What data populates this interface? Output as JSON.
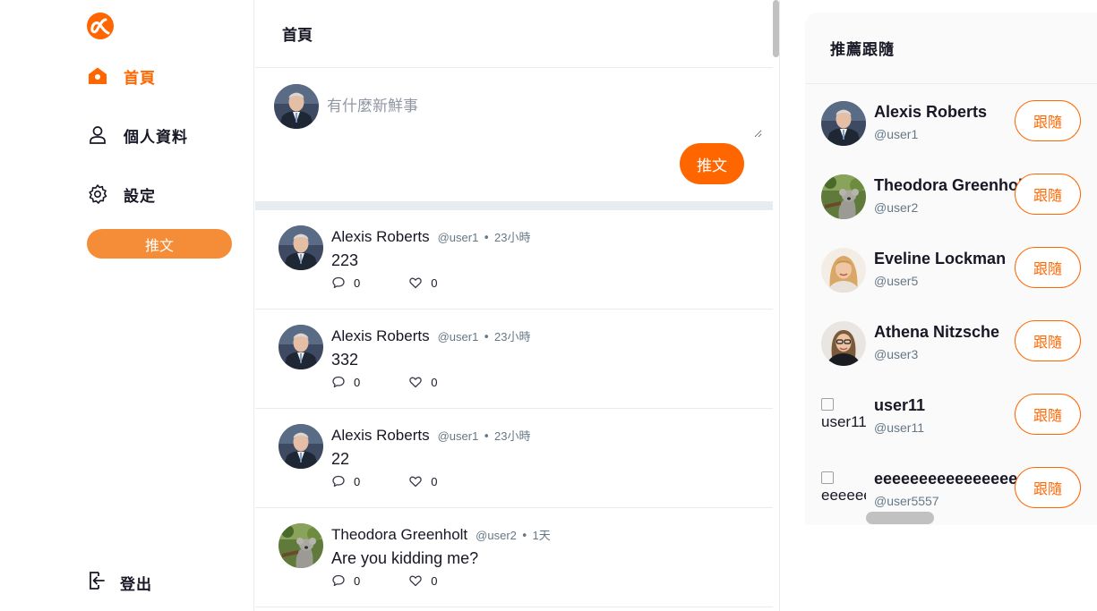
{
  "colors": {
    "accent": "#ff6600",
    "accent_soft": "#f58c37",
    "border": "#e6ecf0",
    "muted": "#657786"
  },
  "sidebar": {
    "logo_icon": "alphitter-logo",
    "nav": [
      {
        "label": "首頁",
        "icon": "home-icon",
        "active": true
      },
      {
        "label": "個人資料",
        "icon": "user-icon",
        "active": false
      },
      {
        "label": "設定",
        "icon": "gear-icon",
        "active": false
      }
    ],
    "tweet_button": "推文",
    "logout": {
      "label": "登出",
      "icon": "logout-icon"
    }
  },
  "main": {
    "title": "首頁",
    "composer": {
      "placeholder": "有什麼新鮮事",
      "submit": "推文"
    },
    "tweets": [
      {
        "name": "Alexis Roberts",
        "handle": "@user1",
        "sep": "•",
        "time": "23小時",
        "content": "223",
        "replies": "0",
        "likes": "0",
        "avatar": "man"
      },
      {
        "name": "Alexis Roberts",
        "handle": "@user1",
        "sep": "•",
        "time": "23小時",
        "content": "332",
        "replies": "0",
        "likes": "0",
        "avatar": "man"
      },
      {
        "name": "Alexis Roberts",
        "handle": "@user1",
        "sep": "•",
        "time": "23小時",
        "content": "22",
        "replies": "0",
        "likes": "0",
        "avatar": "man"
      },
      {
        "name": "Theodora Greenholt",
        "handle": "@user2",
        "sep": "•",
        "time": "1天",
        "content": "Are you kidding me?",
        "replies": "0",
        "likes": "0",
        "avatar": "koala"
      }
    ]
  },
  "recommend": {
    "title": "推薦跟隨",
    "follow_label": "跟隨",
    "users": [
      {
        "name": "Alexis Roberts",
        "handle": "@user1",
        "avatar": "man"
      },
      {
        "name": "Theodora Greenholt",
        "handle": "@user2",
        "avatar": "koala"
      },
      {
        "name": "Eveline Lockman",
        "handle": "@user5",
        "avatar": "woman-blonde"
      },
      {
        "name": "Athena Nitzsche",
        "handle": "@user3",
        "avatar": "woman-glasses"
      },
      {
        "name": "user11",
        "handle": "@user11",
        "avatar": "broken",
        "alt": "user11"
      },
      {
        "name": "eeeeeeeeeeeeeeee",
        "handle": "@user5557",
        "avatar": "broken",
        "alt": "eeeeeeeeeeeeeeee"
      }
    ]
  }
}
